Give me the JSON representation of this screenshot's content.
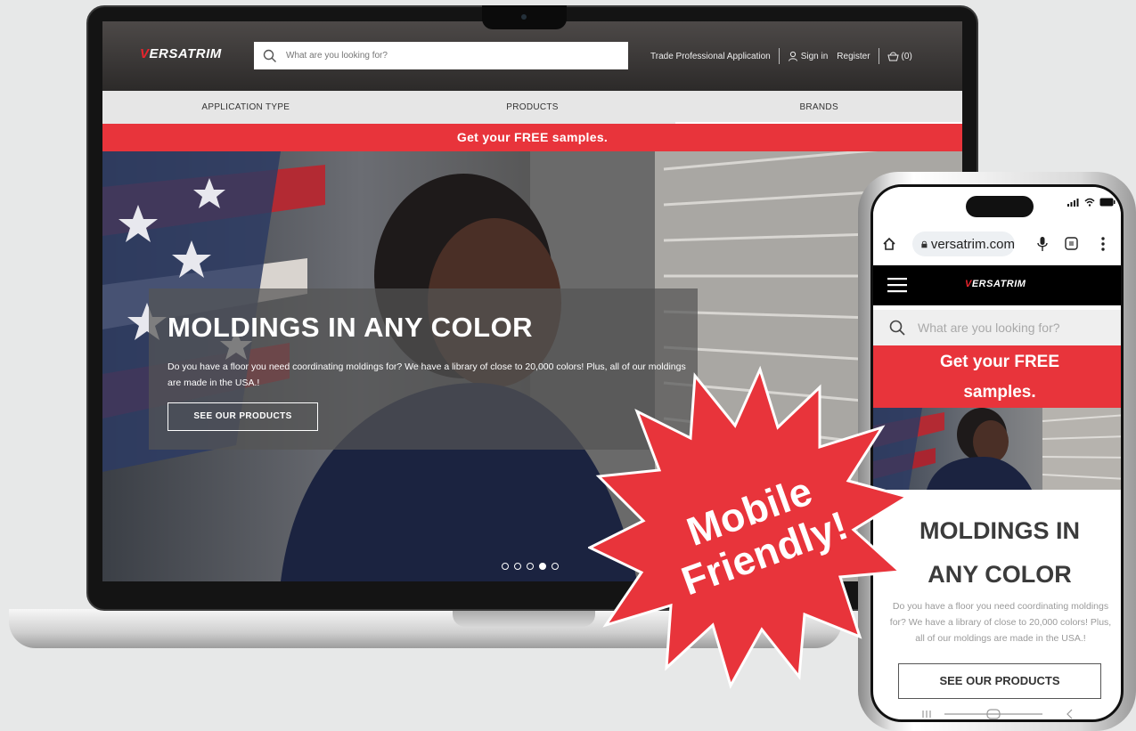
{
  "desktop": {
    "logo": {
      "v": "V",
      "rest": "ERSATRIM"
    },
    "search_placeholder": "What are you looking for?",
    "header_links": {
      "trade": "Trade Professional Application",
      "signin": "Sign in",
      "register": "Register",
      "cart": "(0)"
    },
    "menu": [
      "APPLICATION TYPE",
      "PRODUCTS",
      "BRANDS"
    ],
    "promo": "Get your FREE samples.",
    "hero": {
      "title": "MOLDINGS IN ANY COLOR",
      "text": "Do you have a floor you need coordinating moldings for? We have a library of close to 20,000 colors! Plus, all of our moldings are made in the USA.!",
      "button": "SEE OUR PRODUCTS",
      "slide_count": 5,
      "active_slide": 4
    }
  },
  "mobile": {
    "url": "versatrim.com",
    "logo": {
      "v": "V",
      "rest": "ERSATRIM"
    },
    "search_placeholder": "What are you looking for?",
    "promo_line1": "Get your FREE",
    "promo_line2": "samples.",
    "title_line1": "MOLDINGS IN",
    "title_line2": "ANY COLOR",
    "text": "Do you have a floor you need coordinating moldings for? We have a library of close to 20,000 colors! Plus, all of our moldings are made in the USA.!",
    "button": "SEE OUR PRODUCTS"
  },
  "badge": {
    "line1": "Mobile",
    "line2": "Friendly!"
  },
  "colors": {
    "brand_red": "#e8343b",
    "header_dark": "#2c2a29",
    "menu_gray": "#e6e6e6"
  }
}
